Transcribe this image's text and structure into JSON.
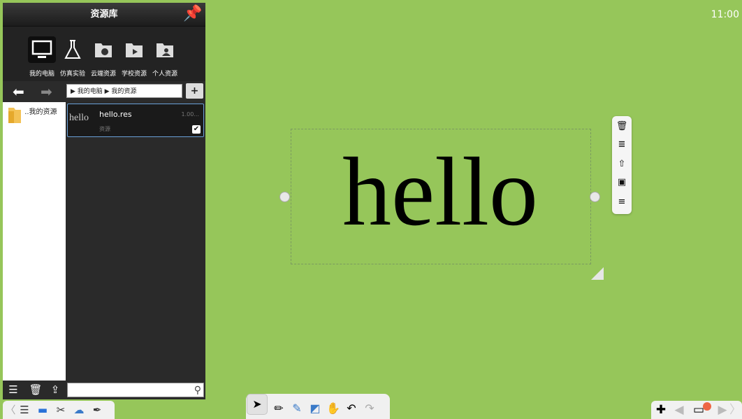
{
  "panel": {
    "title": "资源库",
    "categories": [
      {
        "label": "我的电脑",
        "icon": "monitor-icon",
        "selected": true
      },
      {
        "label": "仿真实验",
        "icon": "flask-icon",
        "selected": false
      },
      {
        "label": "云端资源",
        "icon": "cloud-folder-icon",
        "selected": false
      },
      {
        "label": "学校资源",
        "icon": "school-folder-icon",
        "selected": false
      },
      {
        "label": "个人资源",
        "icon": "personal-folder-icon",
        "selected": false
      }
    ],
    "path": "▶ 我的电脑 ▶ 我的资源",
    "tree_item": "..我的资源",
    "resource": {
      "thumb": "hello",
      "name": "hello.res",
      "type": "资源",
      "size": "1.00...",
      "checked": true
    },
    "search_placeholder": ""
  },
  "clock": "11:00",
  "canvas": {
    "text": "hello",
    "background": "#96c65a"
  },
  "accent": "#6aa0d8"
}
